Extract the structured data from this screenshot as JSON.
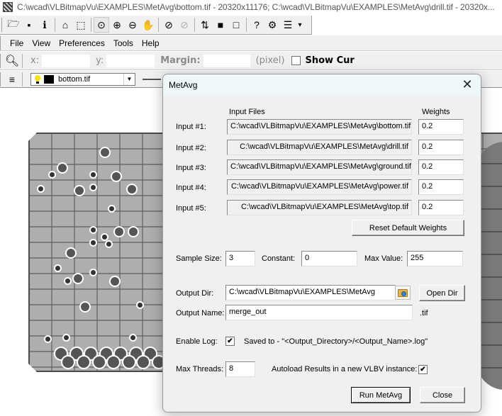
{
  "window": {
    "title": "C:\\wcad\\VLBitmapVu\\EXAMPLES\\MetAvg\\bottom.tif - 20320x11176; C:\\wcad\\VLBitmapVu\\EXAMPLES\\MetAvg\\drill.tif - 20320x..."
  },
  "toolbar": {
    "buttons": [
      {
        "name": "open-icon",
        "glyph": "🗁"
      },
      {
        "name": "save-icon",
        "glyph": "▪"
      },
      {
        "name": "info-icon",
        "glyph": "ℹ"
      },
      {
        "name": "home-icon",
        "glyph": "⌂"
      },
      {
        "name": "select-icon",
        "glyph": "⬚"
      },
      {
        "name": "zoom-window-icon",
        "glyph": "⊙"
      },
      {
        "name": "zoom-in-icon",
        "glyph": "⊕"
      },
      {
        "name": "zoom-out-icon",
        "glyph": "⊖"
      },
      {
        "name": "pan-hand-icon",
        "glyph": "✋"
      },
      {
        "name": "zoom-extents-icon",
        "glyph": "⊘"
      },
      {
        "name": "zoom-previous-icon",
        "glyph": "⊘"
      },
      {
        "name": "swap-layers-icon",
        "glyph": "⇅"
      },
      {
        "name": "black-background-icon",
        "glyph": "■"
      },
      {
        "name": "white-background-icon",
        "glyph": "□"
      },
      {
        "name": "measure-help-icon",
        "glyph": "?"
      },
      {
        "name": "settings-icon",
        "glyph": "⚙"
      },
      {
        "name": "list-icon",
        "glyph": "☰"
      },
      {
        "name": "more-dropdown-icon",
        "glyph": "▾"
      }
    ]
  },
  "menu": {
    "items": [
      "File",
      "View",
      "Preferences",
      "Tools",
      "Help"
    ]
  },
  "coordbar": {
    "x_label": "x:",
    "y_label": "y:",
    "margin_label": "Margin:",
    "unit_label": "(pixel)",
    "show_cursor_label": "Show Cur",
    "x_value": "",
    "y_value": "",
    "margin_value": ""
  },
  "layerbar": {
    "selected_layer": "bottom.tif"
  },
  "dialog": {
    "title": "MetAvg",
    "input_files_header": "Input Files",
    "weights_header": "Weights",
    "inputs": [
      {
        "label": "Input #1:",
        "path": "C:\\wcad\\VLBitmapVu\\EXAMPLES\\MetAvg\\bottom.tif",
        "weight": "0.2"
      },
      {
        "label": "Input #2:",
        "path": "C:\\wcad\\VLBitmapVu\\EXAMPLES\\MetAvg\\drill.tif",
        "weight": "0.2"
      },
      {
        "label": "Input #3:",
        "path": "C:\\wcad\\VLBitmapVu\\EXAMPLES\\MetAvg\\ground.tif",
        "weight": "0.2"
      },
      {
        "label": "Input #4:",
        "path": "C:\\wcad\\VLBitmapVu\\EXAMPLES\\MetAvg\\power.tif",
        "weight": "0.2"
      },
      {
        "label": "Input #5:",
        "path": "C:\\wcad\\VLBitmapVu\\EXAMPLES\\MetAvg\\top.tif",
        "weight": "0.2"
      }
    ],
    "reset_weights_label": "Reset Default Weights",
    "sample_size_label": "Sample Size:",
    "sample_size_value": "3",
    "constant_label": "Constant:",
    "constant_value": "0",
    "max_value_label": "Max Value:",
    "max_value_value": "255",
    "output_dir_label": "Output Dir:",
    "output_dir_value": "C:\\wcad\\VLBitmapVu\\EXAMPLES\\MetAvg",
    "open_dir_label": "Open Dir",
    "output_name_label": "Output Name:",
    "output_name_value": "merge_out",
    "output_ext": ".tif",
    "enable_log_label": "Enable Log:",
    "enable_log_checked": true,
    "log_note": "Saved to - \"<Output_Directory>/<Output_Name>.log\"",
    "max_threads_label": "Max Threads:",
    "max_threads_value": "8",
    "autoload_label": "Autoload Results in a new VLBV instance:",
    "autoload_checked": true,
    "run_label": "Run MetAvg",
    "close_label": "Close",
    "check_glyph": "✔"
  }
}
